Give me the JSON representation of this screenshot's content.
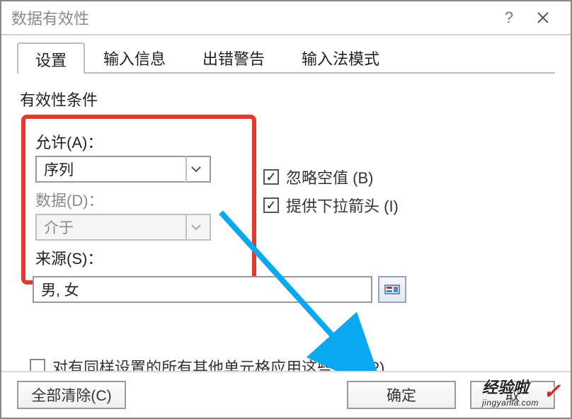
{
  "titlebar": {
    "title": "数据有效性",
    "help": "?"
  },
  "tabs": [
    {
      "label": "设置"
    },
    {
      "label": "输入信息"
    },
    {
      "label": "出错警告"
    },
    {
      "label": "输入法模式"
    }
  ],
  "criteria": {
    "legend": "有效性条件",
    "allow_label": "允许(A)：",
    "allow_value": "序列",
    "data_label": "数据(D)：",
    "data_value": "介于",
    "source_label": "来源(S)：",
    "source_value": "男, 女"
  },
  "checks": {
    "ignore_blank": "忽略空值 (B)",
    "dropdown": "提供下拉箭头 (I)"
  },
  "apply_others": "对有同样设置的所有其他单元格应用这些更改(P)",
  "buttons": {
    "clear_all": "全部清除(C)",
    "ok": "确定",
    "cancel": "取"
  },
  "watermark": {
    "brand": "经验啦",
    "url": "jingyanla.com",
    "check": "✓"
  }
}
